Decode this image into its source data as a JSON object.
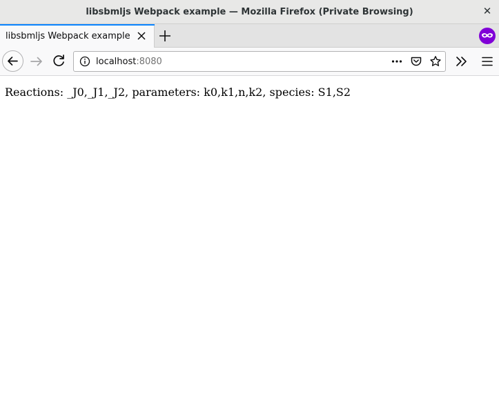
{
  "window": {
    "title": "libsbmljs Webpack example — Mozilla Firefox (Private Browsing)",
    "close_glyph": "✕"
  },
  "tabs": [
    {
      "label": "libsbmljs Webpack example",
      "active": true
    }
  ],
  "navbar": {
    "url_host": "localhost",
    "url_port": ":8080"
  },
  "page": {
    "text": "Reactions: _J0,_J1,_J2, parameters: k0,k1,n,k2, species: S1,S2"
  },
  "colors": {
    "accent": "#0a84ff",
    "private": "#8000d7"
  },
  "icons": [
    "close-icon",
    "tab-close-icon",
    "new-tab-icon",
    "private-browsing-icon",
    "back-arrow-icon",
    "forward-arrow-icon",
    "reload-icon",
    "info-icon",
    "more-actions-icon",
    "pocket-icon",
    "bookmark-star-icon",
    "overflow-chevron-icon",
    "hamburger-menu-icon"
  ]
}
